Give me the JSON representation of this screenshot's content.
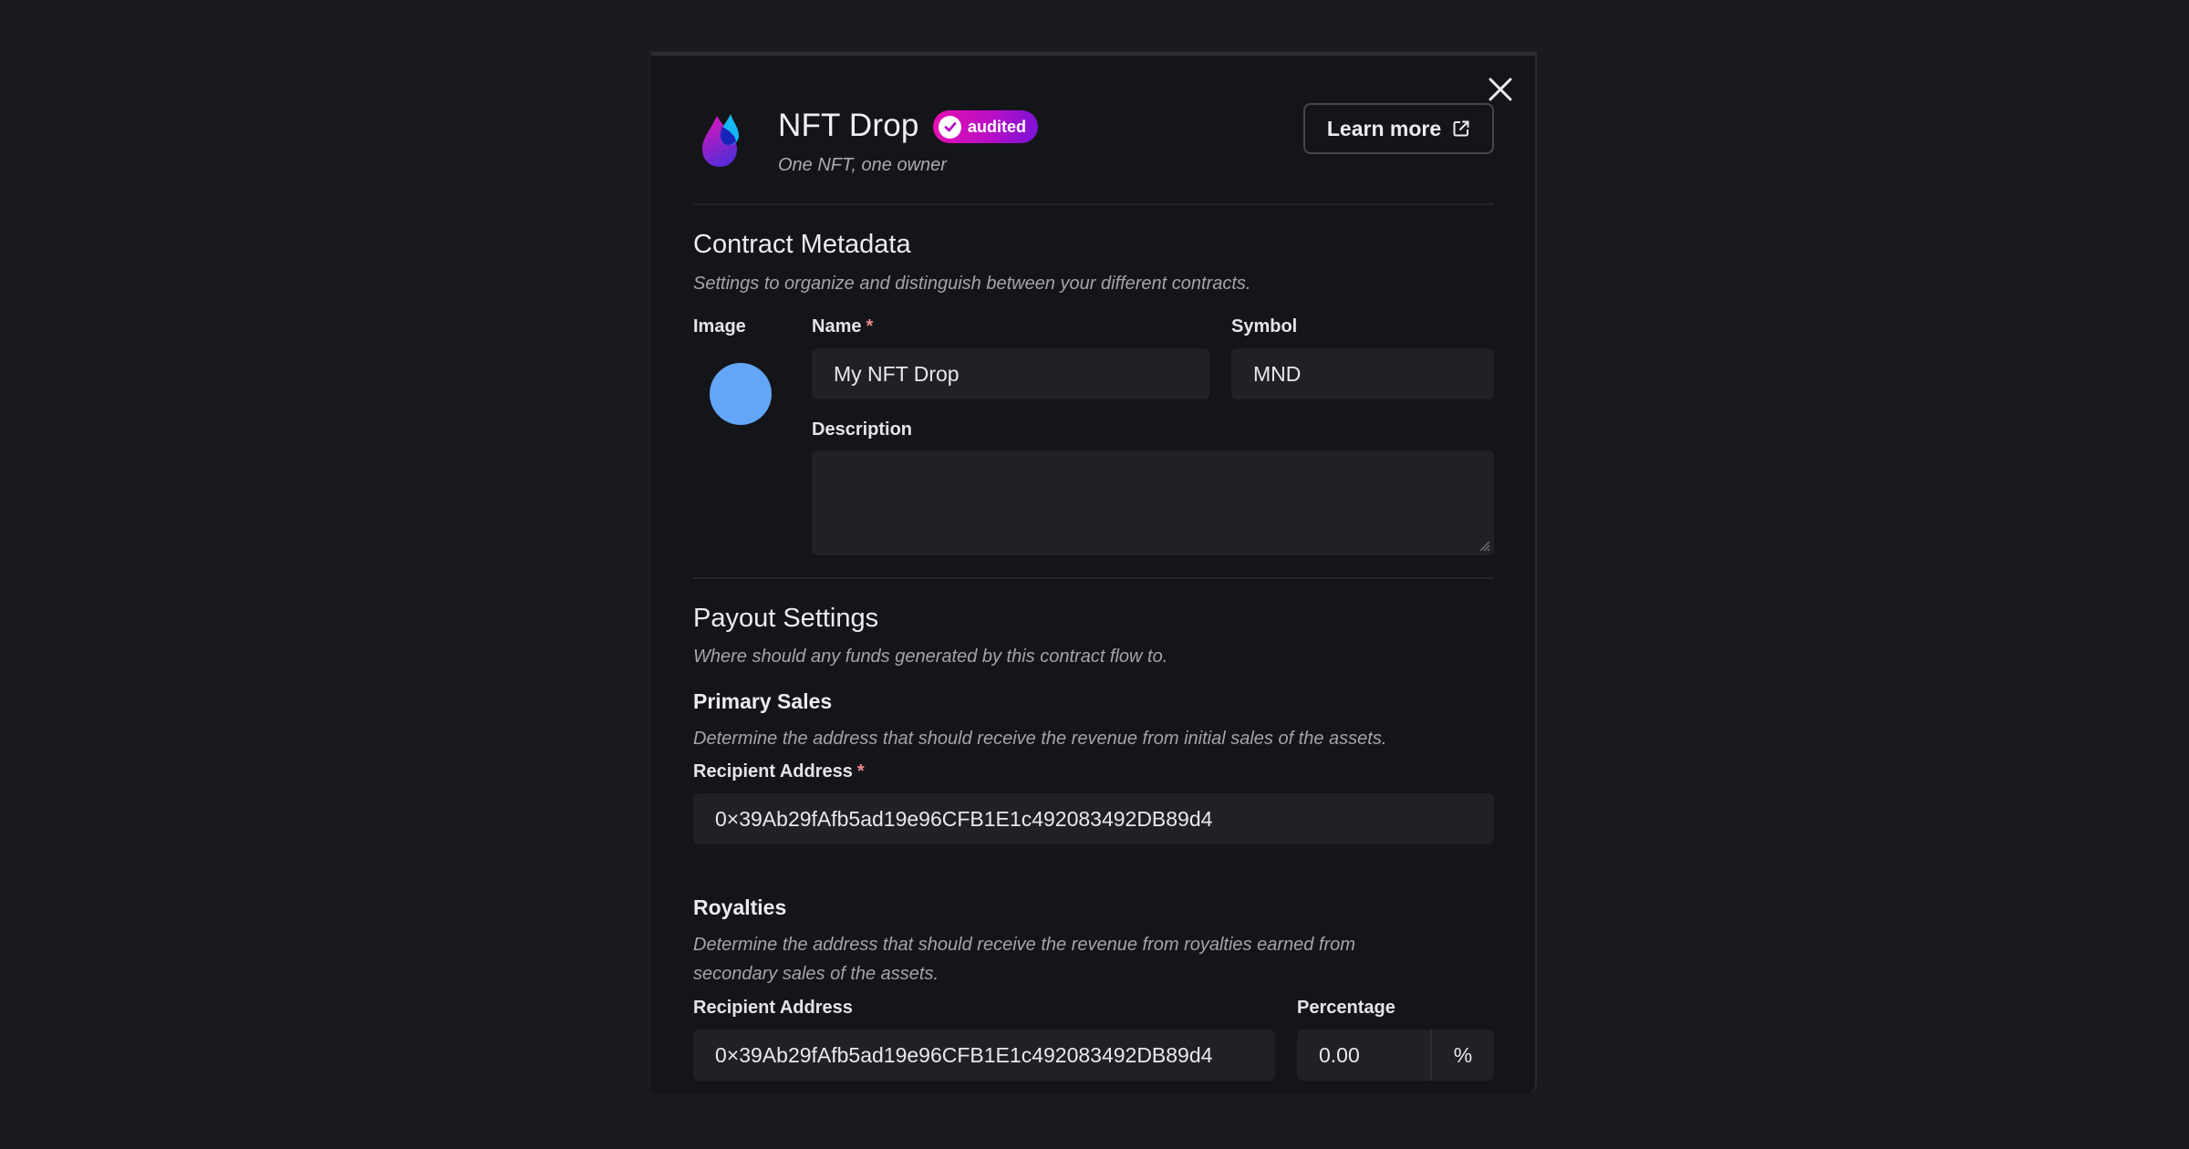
{
  "modal": {
    "close_icon": "close-icon",
    "header": {
      "logo_icon": "nft-drop-logo-icon",
      "title": "NFT Drop",
      "badge": {
        "icon": "check-circle-icon",
        "label": "audited",
        "gradient_from": "#e70fb0",
        "gradient_to": "#7a12d8"
      },
      "subtitle": "One NFT, one owner",
      "learn_more_label": "Learn more",
      "learn_more_icon": "external-link-icon"
    },
    "contract_metadata": {
      "heading": "Contract Metadata",
      "description": "Settings to organize and distinguish between your different contracts.",
      "image_label": "Image",
      "image_placeholder_color": "#63a6f8",
      "name_label": "Name",
      "name_required_mark": "*",
      "name_value": "My NFT Drop",
      "symbol_label": "Symbol",
      "symbol_value": "MND",
      "description_label": "Description",
      "description_value": ""
    },
    "payout_settings": {
      "heading": "Payout Settings",
      "description": "Where should any funds generated by this contract flow to.",
      "primary_sales": {
        "heading": "Primary Sales",
        "description": "Determine the address that should receive the revenue from initial sales of the assets.",
        "recipient_label": "Recipient Address",
        "required_mark": "*",
        "recipient_value": "0×39Ab29fAfb5ad19e96CFB1E1c492083492DB89d4"
      },
      "royalties": {
        "heading": "Royalties",
        "description": "Determine the address that should receive the revenue from royalties earned from secondary sales of the assets.",
        "recipient_label": "Recipient Address",
        "recipient_value": "0×39Ab29fAfb5ad19e96CFB1E1c492083492DB89d4",
        "percentage_label": "Percentage",
        "percentage_value": "0.00",
        "percentage_suffix": "%"
      }
    }
  }
}
